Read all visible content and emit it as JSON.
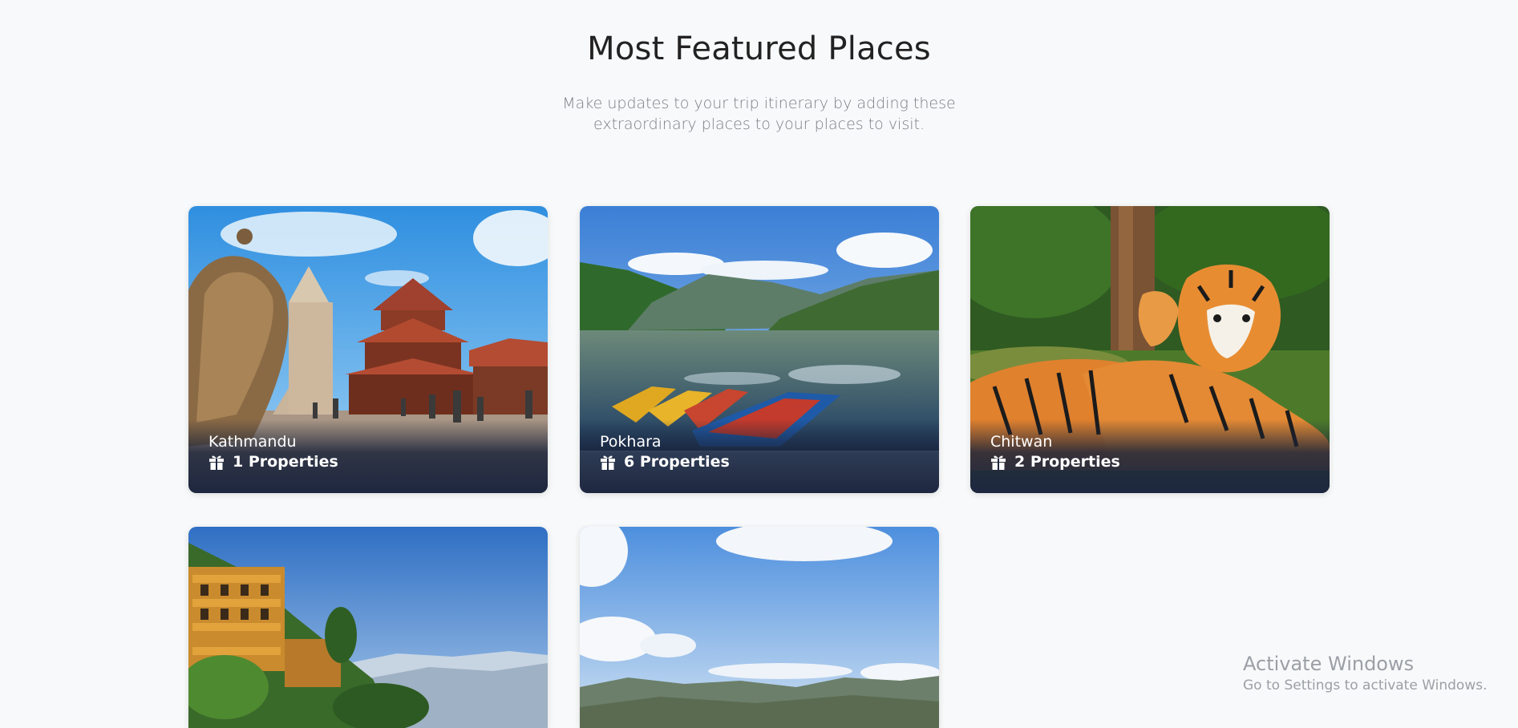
{
  "section": {
    "title": "Most Featured Places",
    "subtitle": "Make updates to your trip itinerary by adding these extraordinary places to your places to visit."
  },
  "places": [
    {
      "name": "Kathmandu",
      "properties": "1 Properties",
      "icon": "gift-icon"
    },
    {
      "name": "Pokhara",
      "properties": "6 Properties",
      "icon": "gift-icon"
    },
    {
      "name": "Chitwan",
      "properties": "2 Properties",
      "icon": "gift-icon"
    },
    {
      "name": "",
      "properties": "",
      "icon": ""
    },
    {
      "name": "",
      "properties": "",
      "icon": ""
    }
  ],
  "watermark": {
    "title": "Activate Windows",
    "subtitle": "Go to Settings to activate Windows."
  },
  "colors": {
    "background": "#f8f9fa",
    "card_overlay": "#1e2740",
    "heading": "#222222",
    "subtitle": "#7a7f85"
  }
}
